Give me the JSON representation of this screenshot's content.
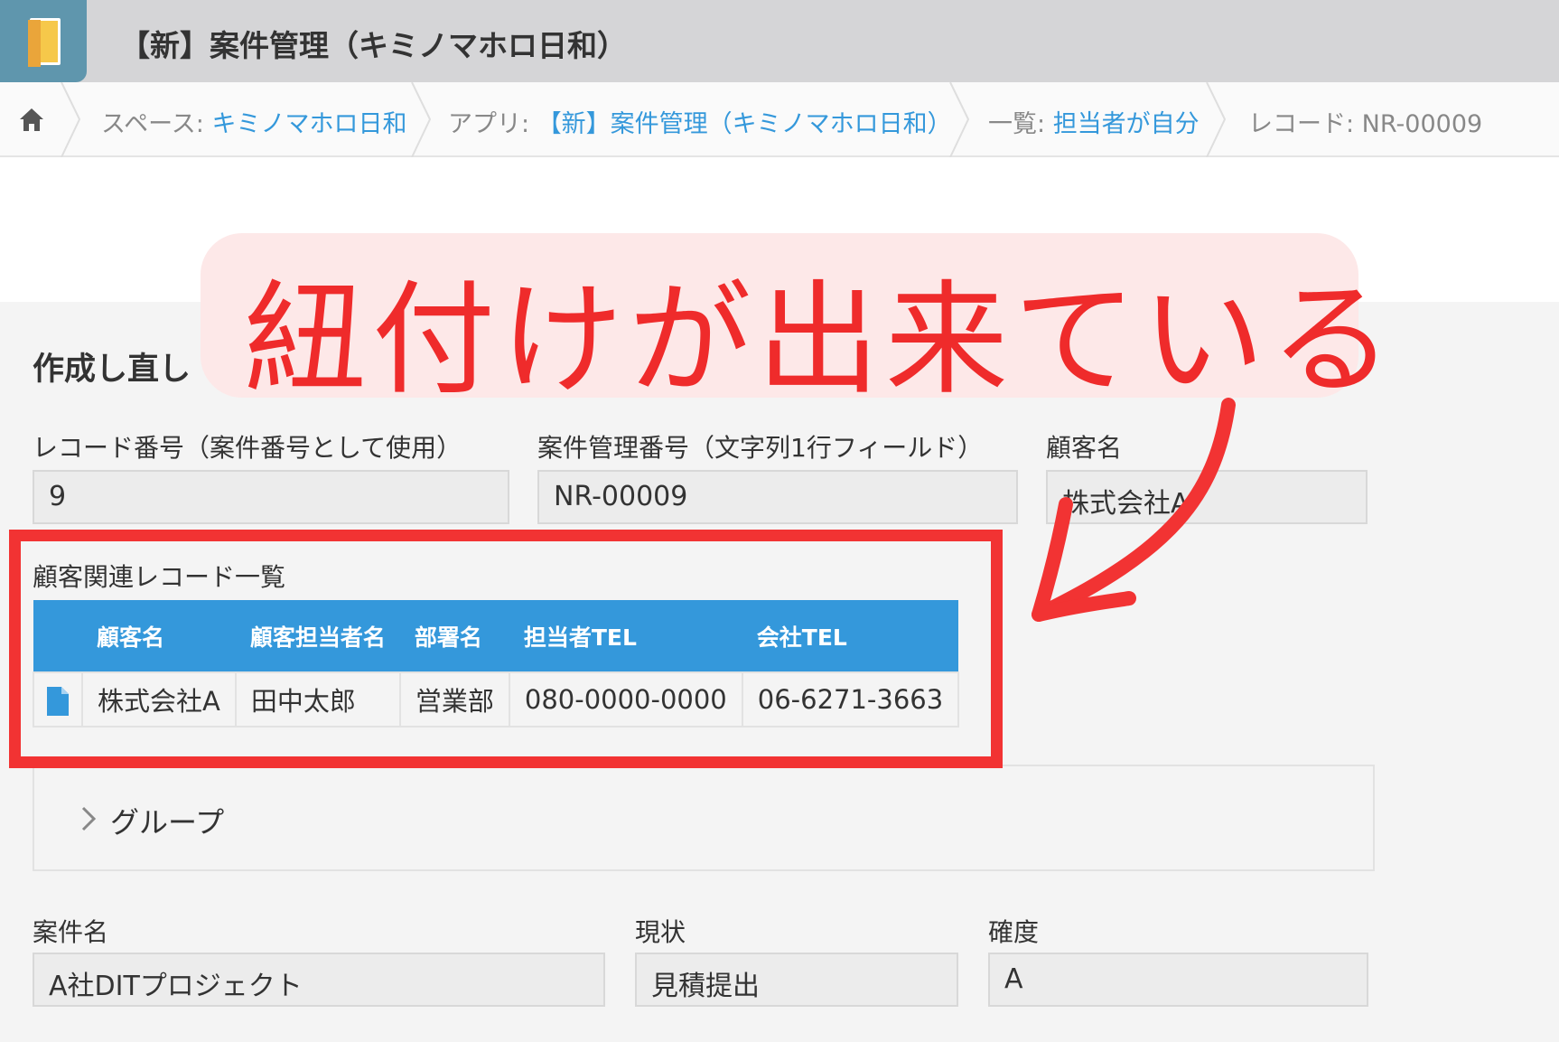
{
  "app": {
    "title": "【新】案件管理（キミノマホロ日和）"
  },
  "breadcrumb": {
    "home_icon": "home-icon",
    "space_label": "スペース: ",
    "space_link": "キミノマホロ日和",
    "app_label": "アプリ: ",
    "app_link": "【新】案件管理（キミノマホロ日和）",
    "view_label": "一覧: ",
    "view_link": "担当者が自分",
    "record_label": "レコード: NR-00009"
  },
  "form": {
    "title_partial": "作成し直し",
    "fields": {
      "record_number": {
        "label": "レコード番号（案件番号として使用）",
        "value": "9"
      },
      "case_number": {
        "label": "案件管理番号（文字列1行フィールド）",
        "value": "NR-00009"
      },
      "customer_name": {
        "label": "顧客名",
        "value": "株式会社A"
      },
      "case_name": {
        "label": "案件名",
        "value": "A社DITプロジェクト"
      },
      "status": {
        "label": "現状",
        "value": "見積提出"
      },
      "certainty": {
        "label": "確度",
        "value": "A"
      }
    },
    "related_records": {
      "title": "顧客関連レコード一覧",
      "columns": [
        "顧客名",
        "顧客担当者名",
        "部署名",
        "担当者TEL",
        "会社TEL"
      ],
      "rows": [
        {
          "icon": "document-icon",
          "cells": [
            "株式会社A",
            "田中太郎",
            "営業部",
            "080-0000-0000",
            "06-6271-3663"
          ]
        }
      ]
    },
    "group": {
      "label": "グループ",
      "icon": "chevron-right-icon"
    }
  },
  "annotation": {
    "callout_text": "紐付けが出来ている",
    "color": "#ef2b2b",
    "background": "#fde8e8"
  },
  "colors": {
    "accent": "#3498db",
    "titlebar": "#d5d5d7"
  }
}
